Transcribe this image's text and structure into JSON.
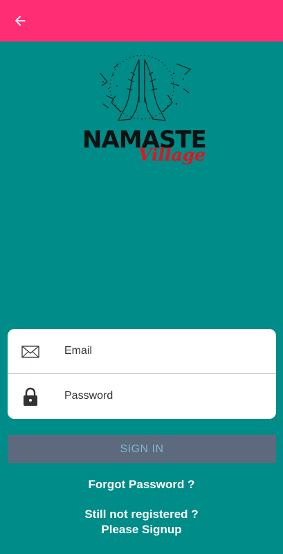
{
  "appbar": {
    "back_icon": "arrow-left-icon",
    "color": "#FF2D74"
  },
  "logo": {
    "name": "NAMASTE",
    "sub": "Village",
    "icon": "praying-hands-icon"
  },
  "form": {
    "email_placeholder": "Email",
    "password_placeholder": "Password",
    "email_icon": "envelope-icon",
    "password_icon": "lock-icon"
  },
  "actions": {
    "sign_in_label": "SIGN IN",
    "forgot_label": "Forgot Password ?",
    "signup_line1": "Still not registered ?",
    "signup_line2": "Please Signup"
  },
  "colors": {
    "background": "#008C88",
    "sign_in_bg": "#5D6A7D",
    "sign_in_text": "#7FB7C8",
    "logo_accent": "#E2141E"
  }
}
